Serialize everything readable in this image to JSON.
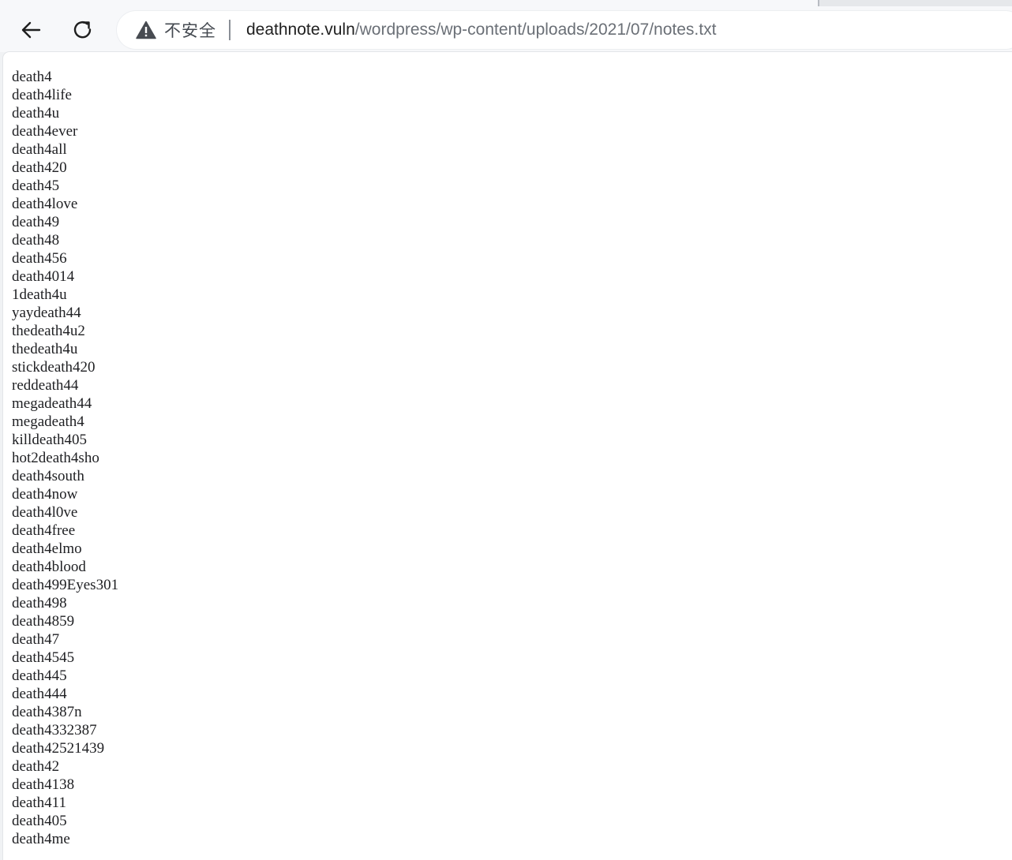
{
  "toolbar": {
    "security_label": "不安全",
    "url_host": "deathnote.vuln",
    "url_path": "/wordpress/wp-content/uploads/2021/07/notes.txt"
  },
  "content": {
    "lines": [
      "death4",
      "death4life",
      "death4u",
      "death4ever",
      "death4all",
      "death420",
      "death45",
      "death4love",
      "death49",
      "death48",
      "death456",
      "death4014",
      "1death4u",
      "yaydeath44",
      "thedeath4u2",
      "thedeath4u",
      "stickdeath420",
      "reddeath44",
      "megadeath44",
      "megadeath4",
      "killdeath405",
      "hot2death4sho",
      "death4south",
      "death4now",
      "death4l0ve",
      "death4free",
      "death4elmo",
      "death4blood",
      "death499Eyes301",
      "death498",
      "death4859",
      "death47",
      "death4545",
      "death445",
      "death444",
      "death4387n",
      "death4332387",
      "death42521439",
      "death42",
      "death4138",
      "death411",
      "death405",
      "death4me"
    ]
  },
  "colors": {
    "toolbar_bg": "#f7f8fa",
    "page_bg": "#ffffff",
    "text": "#202124",
    "url_path": "#6a6f76"
  },
  "icons": {
    "back": "arrow-left-icon",
    "reload": "reload-icon",
    "security": "warning-triangle-icon"
  }
}
